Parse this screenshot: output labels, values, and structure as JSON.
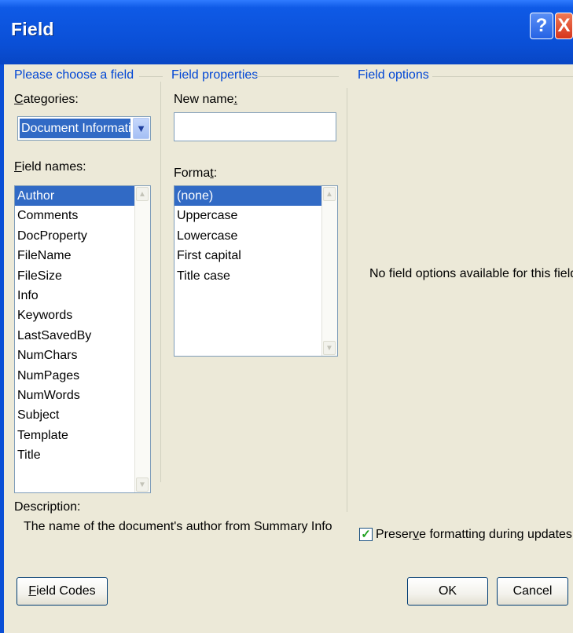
{
  "window": {
    "title": "Field",
    "help_glyph": "?",
    "close_glyph": "X"
  },
  "left": {
    "group_title": "Please choose a field",
    "categories_label": "Categories:",
    "categories_value": "Document Information",
    "field_names_label": "Field names:",
    "field_names": [
      "Author",
      "Comments",
      "DocProperty",
      "FileName",
      "FileSize",
      "Info",
      "Keywords",
      "LastSavedBy",
      "NumChars",
      "NumPages",
      "NumWords",
      "Subject",
      "Template",
      "Title"
    ],
    "selected_field": "Author",
    "description_label": "Description:",
    "description_text": "The name of the document's author from Summary Info"
  },
  "middle": {
    "group_title": "Field properties",
    "new_name_label": "New name:",
    "new_name_value": "",
    "format_label": "Format:",
    "formats": [
      "(none)",
      "Uppercase",
      "Lowercase",
      "First capital",
      "Title case"
    ],
    "selected_format": "(none)"
  },
  "right": {
    "group_title": "Field options",
    "no_options_text": "No field options available for this field",
    "preserve_label": "Preserve formatting during updates",
    "preserve_checked": true
  },
  "buttons": {
    "field_codes": "Field Codes",
    "ok": "OK",
    "cancel": "Cancel"
  },
  "icons": {
    "scroll_up": "▲",
    "scroll_down": "▼",
    "combo_arrow": "▼",
    "check": "✓"
  }
}
